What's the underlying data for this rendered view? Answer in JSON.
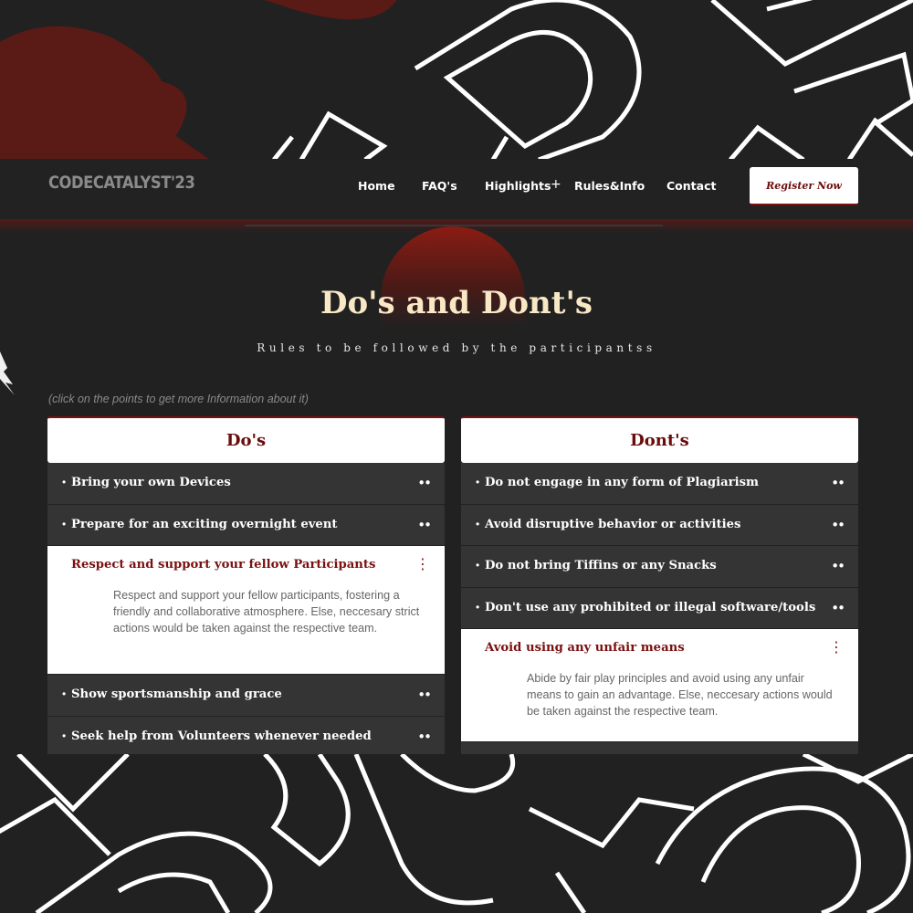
{
  "nav": {
    "logo": "CODECATALYST'23",
    "links": [
      "Home",
      "FAQ's",
      "Highlights",
      "Rules&Info",
      "Contact"
    ],
    "highlights_toggle": "+",
    "register_label": "Register Now"
  },
  "header": {
    "title": "Do's and Dont's",
    "subtitle": "Rules to be followed by the participantss",
    "hint": "(click on the points to get more Information about it)"
  },
  "dos": {
    "heading": "Do's",
    "items": [
      {
        "label": "Bring your own Devices"
      },
      {
        "label": "Prepare for an exciting overnight event"
      },
      {
        "label": "Respect and support your fellow Participants",
        "description": "Respect and support your fellow participants, fostering a friendly and collaborative atmosphere. Else, neccesary strict actions would be taken against the respective team."
      },
      {
        "label": "Show sportsmanship and grace"
      },
      {
        "label": "Seek help from Volunteers whenever needed"
      }
    ]
  },
  "donts": {
    "heading": "Dont's",
    "items": [
      {
        "label": "Do not engage in any form of Plagiarism"
      },
      {
        "label": "Avoid disruptive behavior or activities"
      },
      {
        "label": "Do not bring Tiffins or any Snacks"
      },
      {
        "label": "Don't use any prohibited or illegal software/tools"
      },
      {
        "label": "Avoid using any unfair means",
        "description": "Abide by fair play principles and avoid using any unfair means to gain an advantage. Else, neccesary actions would be taken against the respective team."
      }
    ]
  },
  "glyphs": {
    "bullet": "•",
    "collapsed": "••",
    "expanded": "⋮"
  },
  "colors": {
    "accent": "#7a1010",
    "title": "#f8e8c6",
    "background": "#222121",
    "row": "#353434"
  }
}
